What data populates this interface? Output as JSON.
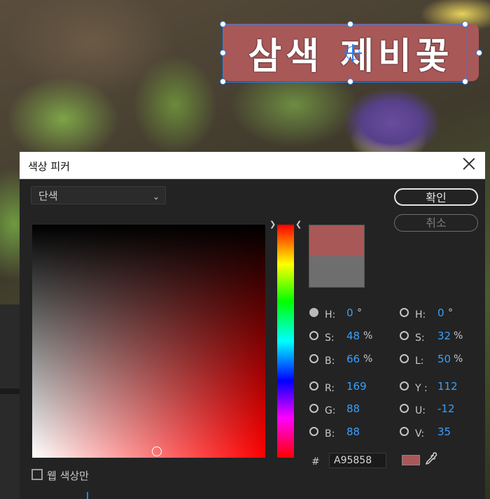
{
  "overlay": {
    "title": "삼색 제비꽃",
    "box_color": "#a95858"
  },
  "dialog": {
    "title": "색상 피커",
    "mode_dropdown": "단색",
    "buttons": {
      "ok": "확인",
      "cancel": "취소"
    },
    "swatches": {
      "new_color": "#a95858",
      "old_color": "#6e6e6e"
    },
    "left_fields": [
      {
        "label": "H:",
        "value": "0",
        "unit": "°",
        "selected": true
      },
      {
        "label": "S:",
        "value": "48",
        "unit": "%",
        "selected": false
      },
      {
        "label": "B:",
        "value": "66",
        "unit": "%",
        "selected": false
      },
      {
        "label": "R:",
        "value": "169",
        "unit": "",
        "selected": false
      },
      {
        "label": "G:",
        "value": "88",
        "unit": "",
        "selected": false
      },
      {
        "label": "B:",
        "value": "88",
        "unit": "",
        "selected": false
      }
    ],
    "right_fields": [
      {
        "label": "H:",
        "value": "0",
        "unit": "°",
        "selected": false
      },
      {
        "label": "S:",
        "value": "32",
        "unit": "%",
        "selected": false
      },
      {
        "label": "L:",
        "value": "50",
        "unit": "%",
        "selected": false
      },
      {
        "label": "Y :",
        "value": "112",
        "unit": "",
        "selected": false
      },
      {
        "label": "U:",
        "value": "-12",
        "unit": "",
        "selected": false
      },
      {
        "label": "V:",
        "value": "35",
        "unit": "",
        "selected": false
      }
    ],
    "hex_symbol": "#",
    "hex_value": "A95858",
    "web_colors_only": {
      "label": "웹 색상만",
      "checked": false
    },
    "accent_color": "#3aa0ff"
  }
}
